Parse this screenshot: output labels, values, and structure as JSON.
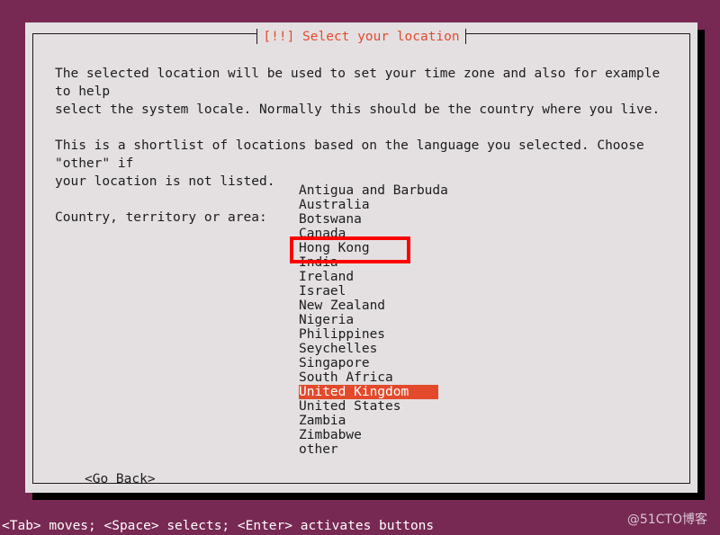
{
  "screen": {
    "background_color": "#772953",
    "dialog_background_color": "#e4e0e2",
    "accent_color": "#e34a2c",
    "annotation_color": "#ff0000"
  },
  "dialog": {
    "title": "[!!] Select your location",
    "paragraphs": [
      "The selected location will be used to set your time zone and also for example to help\nselect the system locale. Normally this should be the country where you live.",
      "This is a shortlist of locations based on the language you selected. Choose \"other\" if\nyour location is not listed."
    ],
    "list_label": "Country, territory or area:",
    "countries": [
      "Antigua and Barbuda",
      "Australia",
      "Botswana",
      "Canada",
      "Hong Kong",
      "India",
      "Ireland",
      "Israel",
      "New Zealand",
      "Nigeria",
      "Philippines",
      "Seychelles",
      "Singapore",
      "South Africa",
      "United Kingdom",
      "United States",
      "Zambia",
      "Zimbabwe",
      "other"
    ],
    "selected_country": "United Kingdom",
    "annotated_country": "Hong Kong",
    "go_back_label": "<Go Back>"
  },
  "footer": {
    "help_text": "<Tab> moves; <Space> selects; <Enter> activates buttons",
    "watermark": "@51CTO博客"
  }
}
